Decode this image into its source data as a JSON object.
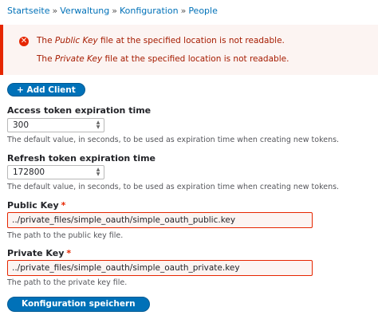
{
  "breadcrumb": {
    "items": [
      "Startseite",
      "Verwaltung",
      "Konfiguration",
      "People"
    ],
    "separator": "»"
  },
  "messages": {
    "error_icon": "error-x-icon",
    "line1": {
      "prefix": "The ",
      "emphasis": "Public Key",
      "suffix": " file at the specified location is not readable."
    },
    "line2": {
      "prefix": "The ",
      "emphasis": "Private Key",
      "suffix": " file at the specified location is not readable."
    }
  },
  "add_client": {
    "label": "+ Add Client"
  },
  "fields": {
    "access_token": {
      "label": "Access token expiration time",
      "value": "300",
      "description": "The default value, in seconds, to be used as expiration time when creating new tokens."
    },
    "refresh_token": {
      "label": "Refresh token expiration time",
      "value": "172800",
      "description": "The default value, in seconds, to be used as expiration time when creating new tokens."
    },
    "public_key": {
      "label": "Public Key",
      "required_mark": "*",
      "value": "../private_files/simple_oauth/simple_oauth_public.key",
      "description": "The path to the public key file."
    },
    "private_key": {
      "label": "Private Key",
      "required_mark": "*",
      "value": "../private_files/simple_oauth/simple_oauth_private.key",
      "description": "The path to the private key file."
    }
  },
  "submit": {
    "label": "Konfiguration speichern"
  },
  "colors": {
    "link": "#0071b8",
    "error": "#e62600",
    "error_text": "#a51b00",
    "error_bg": "#fcf4f2",
    "button": "#0071b8"
  }
}
